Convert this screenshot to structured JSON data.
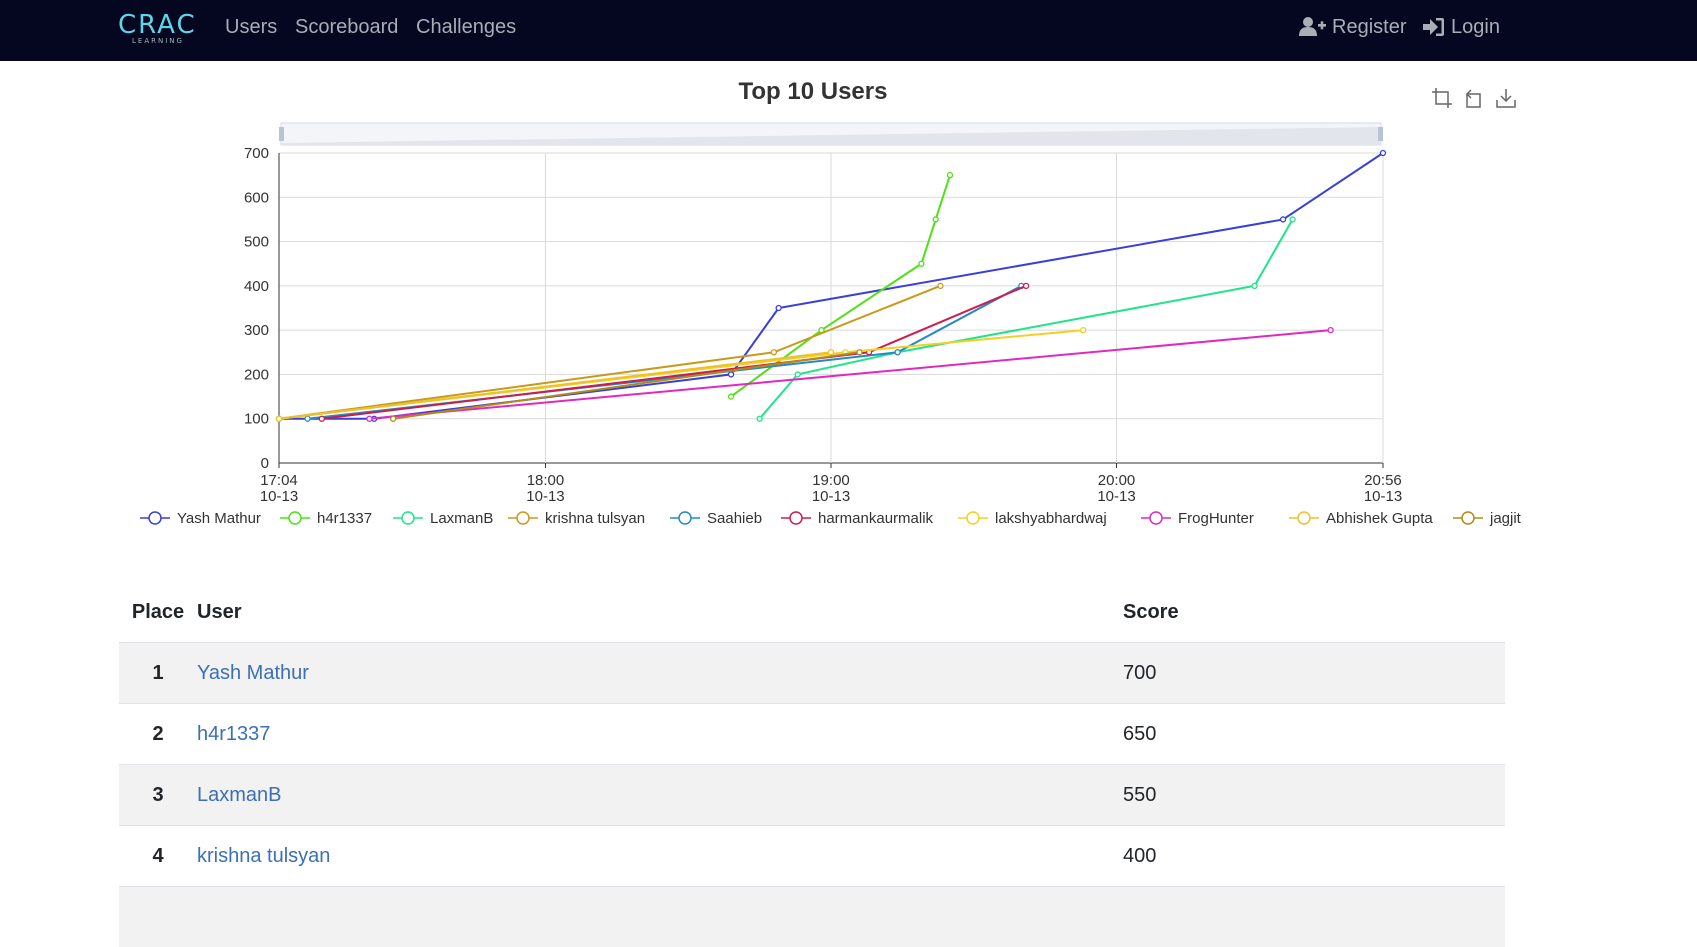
{
  "nav": {
    "logo_main": "CRAC",
    "logo_sub": "LEARNING",
    "links": [
      "Users",
      "Scoreboard",
      "Challenges"
    ],
    "register": "Register",
    "login": "Login"
  },
  "chart_data": {
    "type": "line",
    "title": "Top 10 Users",
    "ylim": [
      0,
      700
    ],
    "yticks": [
      0,
      100,
      200,
      300,
      400,
      500,
      600,
      700
    ],
    "x_range": [
      "10-13 17:04",
      "10-13 20:56"
    ],
    "xticks": [
      {
        "time": "17:04",
        "date": "10-13"
      },
      {
        "time": "18:00",
        "date": "10-13"
      },
      {
        "time": "19:00",
        "date": "10-13"
      },
      {
        "time": "20:00",
        "date": "10-13"
      },
      {
        "time": "20:56",
        "date": "10-13"
      }
    ],
    "grid": true,
    "legend_position": "bottom",
    "series": [
      {
        "name": "Yash Mathur",
        "color": "#3a3fd6",
        "points": [
          [
            "17:04",
            100
          ],
          [
            "17:24",
            100
          ],
          [
            "18:39",
            200
          ],
          [
            "18:49",
            350
          ],
          [
            "20:35",
            550
          ],
          [
            "20:56",
            700
          ]
        ]
      },
      {
        "name": "h4r1337",
        "color": "#4fe017",
        "points": [
          [
            "18:39",
            150
          ],
          [
            "18:58",
            300
          ],
          [
            "19:19",
            450
          ],
          [
            "19:22",
            550
          ],
          [
            "19:25",
            650
          ]
        ]
      },
      {
        "name": "LaxmanB",
        "color": "#1ee587",
        "points": [
          [
            "18:45",
            100
          ],
          [
            "18:53",
            200
          ],
          [
            "19:14",
            250
          ],
          [
            "20:29",
            400
          ],
          [
            "20:37",
            550
          ]
        ]
      },
      {
        "name": "krishna tulsyan",
        "color": "#c9991c",
        "points": [
          [
            "17:04",
            100
          ],
          [
            "18:48",
            250
          ],
          [
            "19:23",
            400
          ]
        ]
      },
      {
        "name": "Saahieb",
        "color": "#2489c9",
        "points": [
          [
            "17:10",
            100
          ],
          [
            "19:14",
            250
          ],
          [
            "19:40",
            400
          ]
        ]
      },
      {
        "name": "harmankaurmalik",
        "color": "#cc1d4d",
        "points": [
          [
            "17:13",
            100
          ],
          [
            "19:08",
            250
          ],
          [
            "19:41",
            400
          ]
        ]
      },
      {
        "name": "lakshyabhardwaj",
        "color": "#f3d022",
        "points": [
          [
            "17:04",
            100
          ],
          [
            "19:03",
            250
          ],
          [
            "19:53",
            300
          ]
        ]
      },
      {
        "name": "FrogHunter",
        "color": "#e129c1",
        "points": [
          [
            "17:23",
            100
          ],
          [
            "20:45",
            300
          ]
        ]
      },
      {
        "name": "Abhishek Gupta",
        "color": "#ecc12a",
        "points": [
          [
            "17:04",
            100
          ],
          [
            "19:00",
            250
          ]
        ]
      },
      {
        "name": "jagjit",
        "color": "#b38a1a",
        "points": [
          [
            "17:28",
            100
          ],
          [
            "19:06",
            250
          ]
        ]
      }
    ]
  },
  "table": {
    "headers": [
      "Place",
      "User",
      "Score"
    ],
    "rows": [
      {
        "place": "1",
        "user": "Yash Mathur",
        "score": "700"
      },
      {
        "place": "2",
        "user": "h4r1337",
        "score": "650"
      },
      {
        "place": "3",
        "user": "LaxmanB",
        "score": "550"
      },
      {
        "place": "4",
        "user": "krishna tulsyan",
        "score": "400"
      }
    ]
  }
}
